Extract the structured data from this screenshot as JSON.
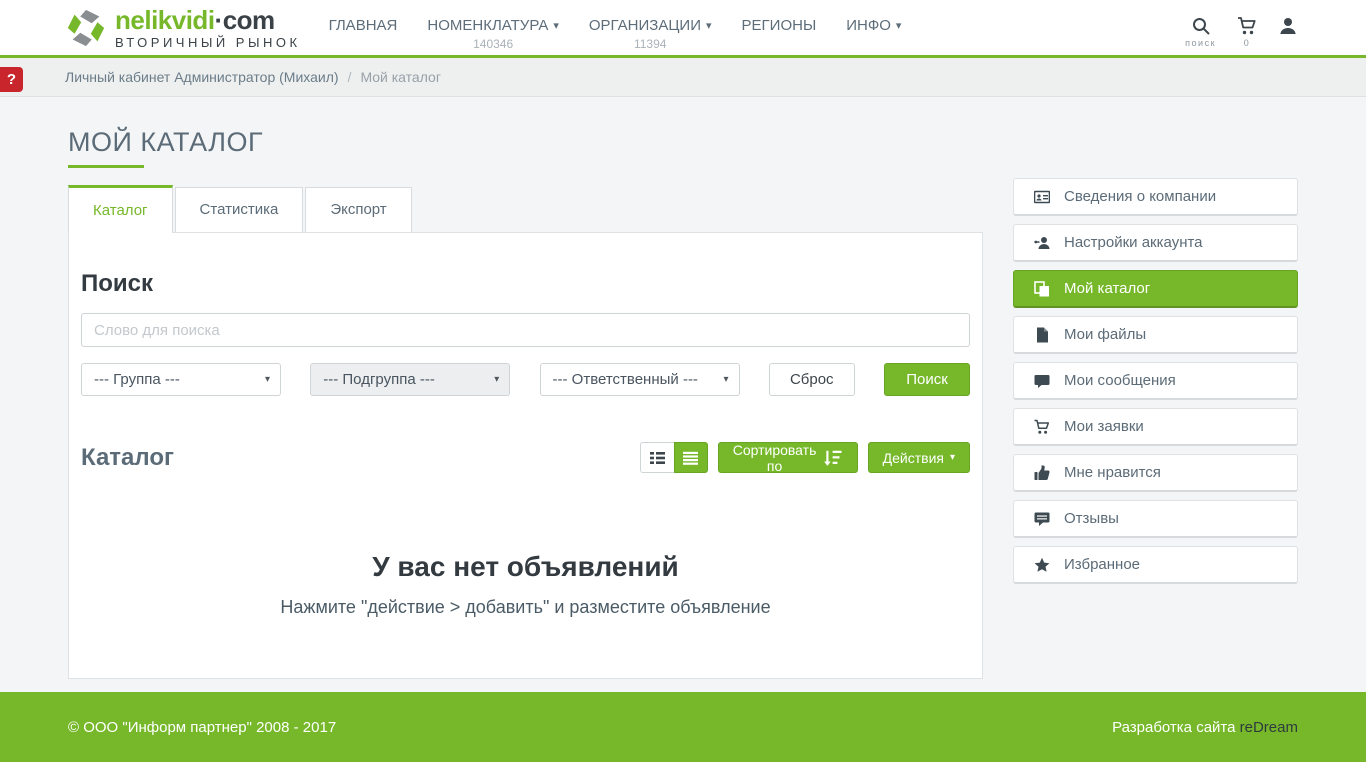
{
  "colors": {
    "accent": "#76b82a",
    "accent_border": "#68a523",
    "danger": "#c9252c",
    "page_bg": "#f4f5f6"
  },
  "icons": {
    "caret_down": "▾",
    "breadcrumb_separator": "/",
    "help": "?"
  },
  "header": {
    "logo": {
      "primary": "nelikvidi",
      "dot": "·",
      "suffix": "com",
      "tagline": "ВТОРИЧНЫЙ РЫНОК"
    },
    "nav": [
      {
        "label": "ГЛАВНАЯ",
        "count": ""
      },
      {
        "label": "НОМЕНКЛАТУРА",
        "count": "140346"
      },
      {
        "label": "ОРГАНИЗАЦИИ",
        "count": "11394"
      },
      {
        "label": "РЕГИОНЫ",
        "count": ""
      },
      {
        "label": "ИНФО",
        "count": ""
      }
    ],
    "search_label": "поиск",
    "cart_count": "0"
  },
  "breadcrumb": {
    "items": [
      "Личный кабинет Администратор (Михаил)",
      "Мой каталог"
    ]
  },
  "page": {
    "title": "МОЙ КАТАЛОГ"
  },
  "tabs": [
    {
      "label": "Каталог"
    },
    {
      "label": "Статистика"
    },
    {
      "label": "Экспорт"
    }
  ],
  "search": {
    "heading": "Поиск",
    "placeholder": "Слово для поиска",
    "group_select": "--- Группа ---",
    "subgroup_select": "--- Подгруппа ---",
    "responsible_select": "--- Ответственный ---",
    "reset_label": "Сброс",
    "submit_label": "Поиск"
  },
  "catalog": {
    "heading": "Каталог",
    "sort_label": "Сортировать по",
    "actions_label": "Действия",
    "empty_title": "У вас нет объявлений",
    "empty_hint": "Нажмите \"действие > добавить\" и разместите объявление"
  },
  "sidebar": {
    "items": [
      {
        "label": "Сведения о компании"
      },
      {
        "label": "Настройки аккаунта"
      },
      {
        "label": "Мой каталог"
      },
      {
        "label": "Мои файлы"
      },
      {
        "label": "Мои сообщения"
      },
      {
        "label": "Мои заявки"
      },
      {
        "label": "Мне нравится"
      },
      {
        "label": "Отзывы"
      },
      {
        "label": "Избранное"
      }
    ]
  },
  "footer": {
    "copyright": "© ООО \"Информ партнер\" 2008 - 2017",
    "dev_label": "Разработка сайта ",
    "dev_name": "reDream"
  }
}
